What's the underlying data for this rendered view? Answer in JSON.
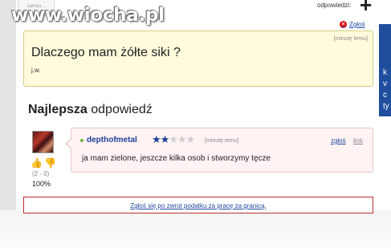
{
  "watermark": {
    "text": "www.wiocha.pl"
  },
  "top_thumbnail": {
    "text": "samsu..."
  },
  "header": {
    "answers_label": "odpowiedzi:",
    "plus": "+"
  },
  "right_panel": {
    "letters": [
      "k",
      "v",
      "c",
      "ty"
    ],
    "color": "#1f4e9e"
  },
  "question": {
    "report": "Zgłoś",
    "time": "[minutę temu]",
    "title": "Dlaczego mam żółte siki ?",
    "details": "j.w."
  },
  "best_answer": {
    "heading_bold": "Najlepsza",
    "heading_rest": " odpowiedź",
    "user": "depthofmetal",
    "rating": {
      "stars_filled": 2,
      "stars_total": 5
    },
    "time": "[minutę temu]",
    "report": "zgłoś",
    "link": "link",
    "text": "ja mam zielone, jeszcze kilka osob i stworzymy tęcze",
    "votes": {
      "tally": "(2 - 0)",
      "percent": "100%"
    }
  },
  "ad": {
    "link_text": "Zgłoś się po zwrot podatku za pracę za granicą."
  },
  "colors": {
    "link": "#2049a0",
    "question_bg": "#fffbdc",
    "answer_bg": "#fff3f3",
    "ad_border": "#c42b2b"
  }
}
